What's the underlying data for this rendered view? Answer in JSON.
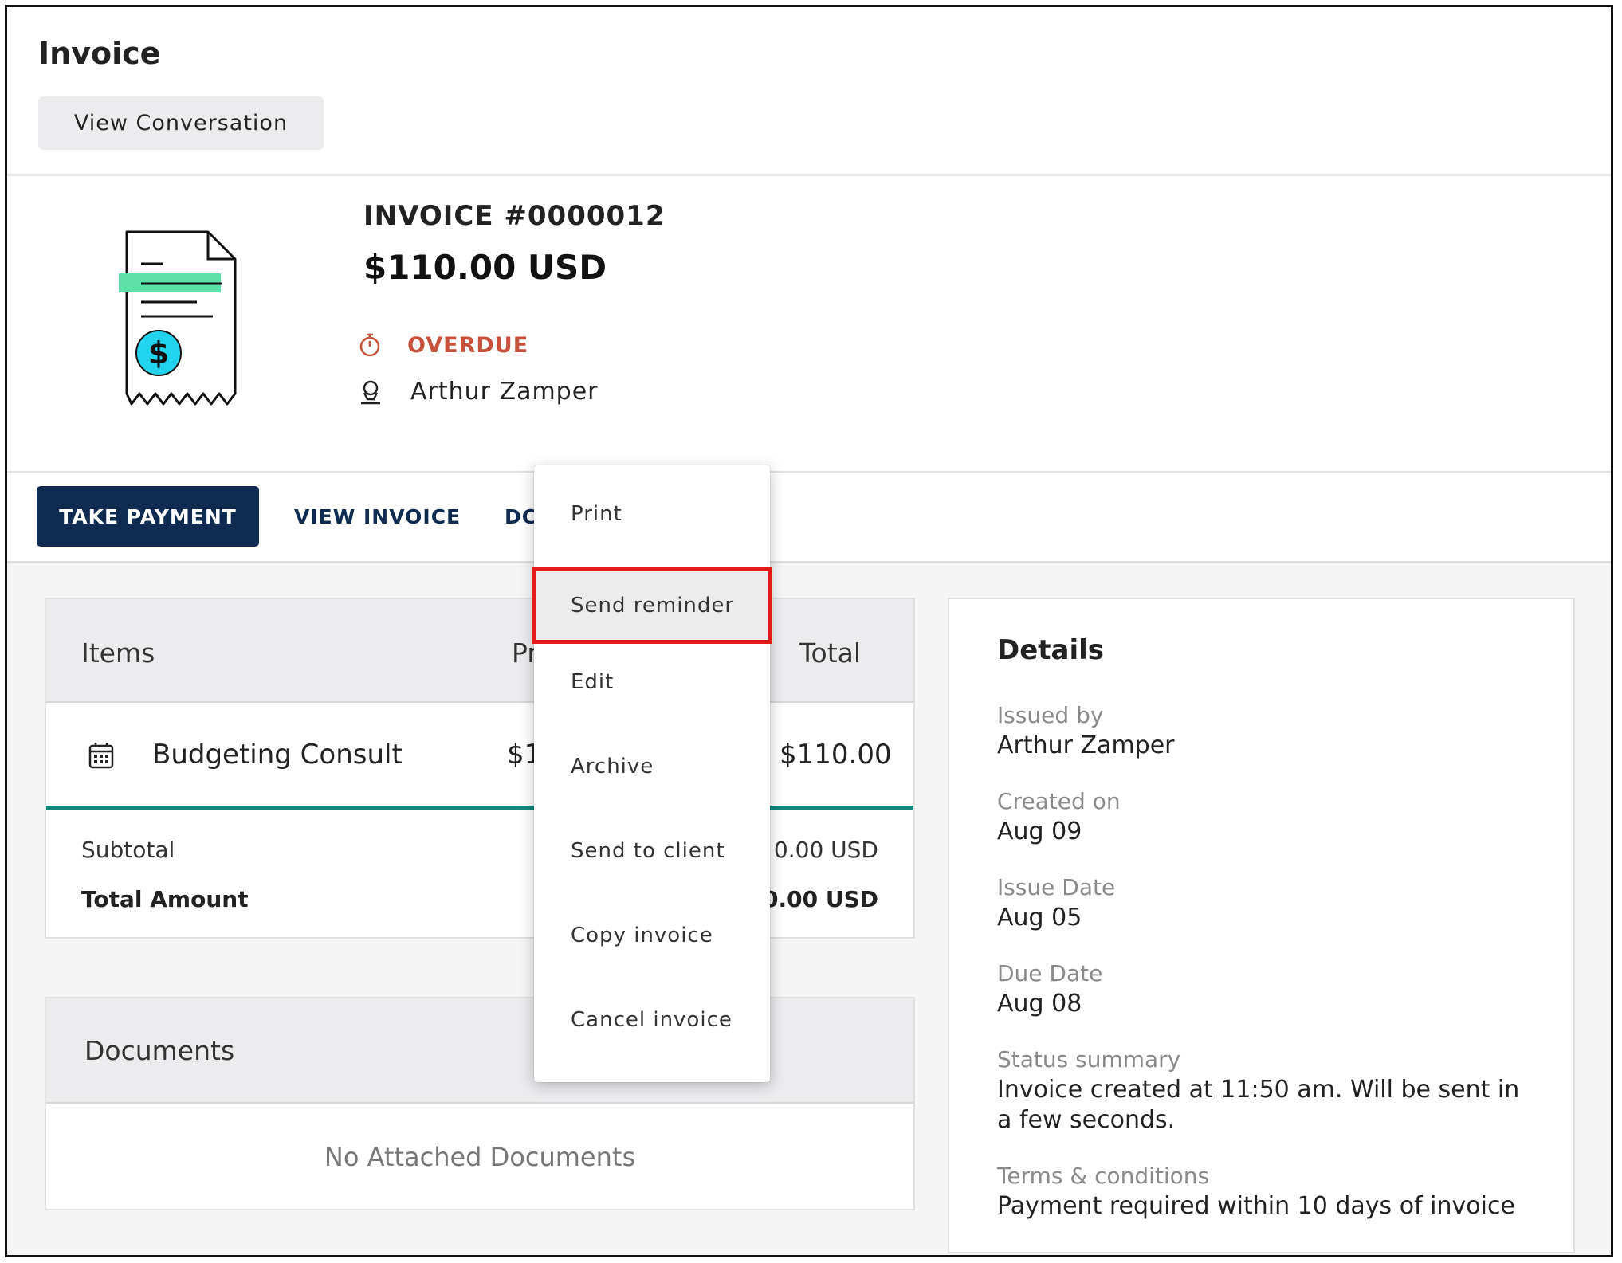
{
  "header": {
    "title": "Invoice",
    "view_conversation_label": "View Conversation"
  },
  "summary": {
    "invoice_number": "INVOICE #0000012",
    "amount": "$110.00 USD",
    "status": "OVERDUE",
    "client": "Arthur Zamper",
    "status_color": "#c8513b"
  },
  "actions": {
    "take_payment": "TAKE PAYMENT",
    "view_invoice": "VIEW INVOICE",
    "more_partial": "DC"
  },
  "menu": {
    "items": [
      "Print",
      "Send reminder",
      "Edit",
      "Archive",
      "Send to client",
      "Copy invoice",
      "Cancel invoice"
    ],
    "highlighted": "Send reminder"
  },
  "items_table": {
    "headers": {
      "items": "Items",
      "price_partial": "Pr",
      "total": "Total"
    },
    "rows": [
      {
        "name": "Budgeting Consult",
        "price_partial": "$1",
        "total": "$110.00"
      }
    ],
    "subtotal_label": "Subtotal",
    "subtotal_value_partial": "0.00 USD",
    "total_label": "Total Amount",
    "total_value_partial": "0.00 USD"
  },
  "documents": {
    "title": "Documents",
    "empty_text": "No Attached Documents"
  },
  "details": {
    "title": "Details",
    "fields": [
      {
        "label": "Issued by",
        "value": "Arthur Zamper"
      },
      {
        "label": "Created on",
        "value": "Aug 09"
      },
      {
        "label": "Issue Date",
        "value": "Aug 05"
      },
      {
        "label": "Due Date",
        "value": "Aug 08"
      },
      {
        "label": "Status summary",
        "value": "Invoice created at 11:50 am. Will be sent in a few seconds."
      },
      {
        "label": "Terms & conditions",
        "value": "Payment required within 10 days of invoice"
      }
    ]
  },
  "colors": {
    "primary": "#0f2b52",
    "accent_green": "#13897a",
    "highlight_box": "#e3191a",
    "illustration_cyan": "#22d3ee",
    "illustration_green": "#5ee0a8"
  }
}
